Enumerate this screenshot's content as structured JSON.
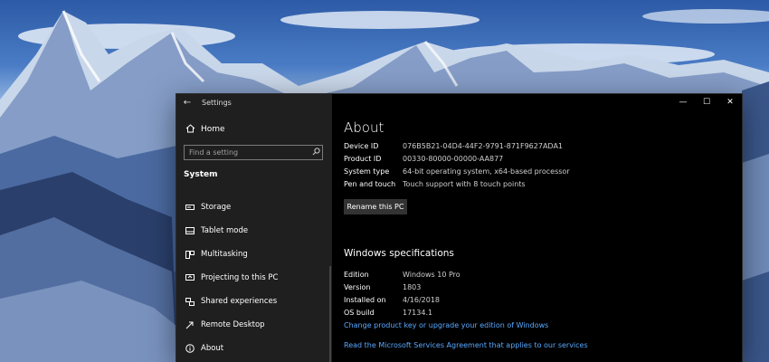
{
  "window": {
    "title": "Settings",
    "back_glyph": "←",
    "controls": {
      "minimize": "—",
      "maximize": "☐",
      "close": "✕"
    }
  },
  "sidebar": {
    "home_label": "Home",
    "search_placeholder": "Find a setting",
    "section_label": "System",
    "items": [
      {
        "label": "Storage",
        "icon": "storage-icon"
      },
      {
        "label": "Tablet mode",
        "icon": "tablet-mode-icon"
      },
      {
        "label": "Multitasking",
        "icon": "multitasking-icon"
      },
      {
        "label": "Projecting to this PC",
        "icon": "projecting-icon"
      },
      {
        "label": "Shared experiences",
        "icon": "shared-experiences-icon"
      },
      {
        "label": "Remote Desktop",
        "icon": "remote-desktop-icon"
      },
      {
        "label": "About",
        "icon": "info-icon",
        "selected": true
      }
    ]
  },
  "about": {
    "title": "About",
    "device_specs": [
      {
        "key": "Device ID",
        "value": "076B5B21-04D4-44F2-9791-871F9627ADA1"
      },
      {
        "key": "Product ID",
        "value": "00330-80000-00000-AA877"
      },
      {
        "key": "System type",
        "value": "64-bit operating system, x64-based processor"
      },
      {
        "key": "Pen and touch",
        "value": "Touch support with 8 touch points"
      }
    ],
    "rename_button": "Rename this PC",
    "windows_spec_title": "Windows specifications",
    "windows_specs": [
      {
        "key": "Edition",
        "value": "Windows 10 Pro"
      },
      {
        "key": "Version",
        "value": "1803"
      },
      {
        "key": "Installed on",
        "value": "4/16/2018"
      },
      {
        "key": "OS build",
        "value": "17134.1"
      }
    ],
    "links": {
      "change_key": "Change product key or upgrade your edition of Windows",
      "services_agreement": "Read the Microsoft Services Agreement that applies to our services"
    }
  },
  "colors": {
    "accent_link": "#5aa9ff",
    "sidebar_bg": "#1f1f1f",
    "content_bg": "#000000"
  }
}
